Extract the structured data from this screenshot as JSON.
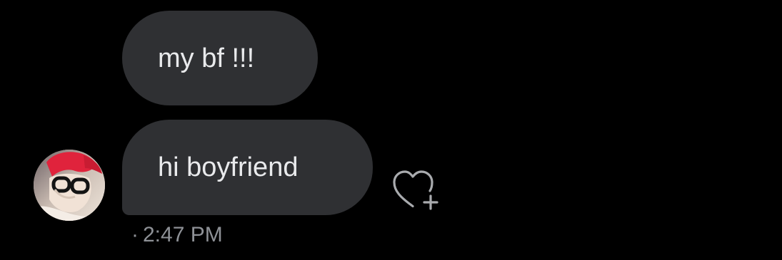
{
  "messages": [
    {
      "text": "my bf !!!"
    },
    {
      "text": "hi boyfriend"
    }
  ],
  "meta": {
    "separator": "·",
    "time": "2:47 PM"
  },
  "icons": {
    "react": "heart-plus-icon",
    "avatar": "avatar"
  },
  "colors": {
    "background": "#000000",
    "bubble": "#2f3033",
    "bubble_text": "#e9eaec",
    "timestamp": "#8e9196",
    "icon_stroke": "#a9abae"
  }
}
